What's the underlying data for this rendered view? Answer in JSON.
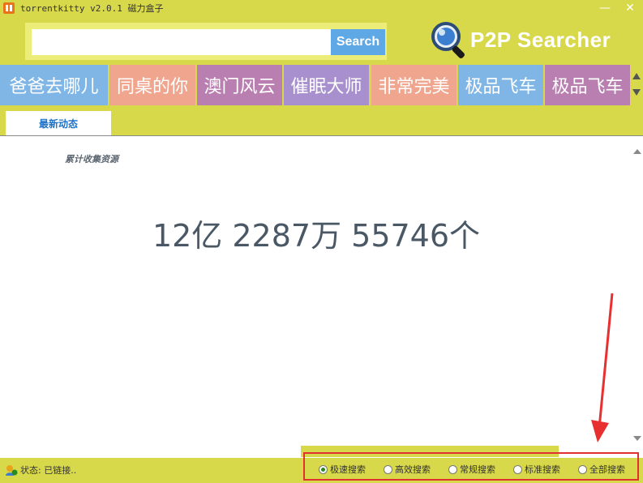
{
  "window": {
    "title": "torrentkitty v2.0.1 磁力盒子",
    "minimize_label": "—",
    "close_label": "✕"
  },
  "search": {
    "input_value": "",
    "button_label": "Search"
  },
  "logo": {
    "text": "P2P Searcher",
    "icon": "magnifier-icon"
  },
  "hot_tabs": [
    {
      "label": "爸爸去哪儿",
      "color": "#7fb6e6"
    },
    {
      "label": "同桌的你",
      "color": "#f0a58e"
    },
    {
      "label": "澳门风云",
      "color": "#b97fb0"
    },
    {
      "label": "催眠大师",
      "color": "#a890cf"
    },
    {
      "label": "非常完美",
      "color": "#f0a58e"
    },
    {
      "label": "极品飞车",
      "color": "#7fb6e6"
    },
    {
      "label": "极品飞车",
      "color": "#b97fb0"
    }
  ],
  "content_tabs": {
    "latest": "最新动态"
  },
  "stats": {
    "label": "累计收集资源",
    "count": "12亿 2287万 55746个"
  },
  "status": {
    "text": "状态: 已链接.."
  },
  "search_modes": [
    {
      "label": "极速搜索",
      "selected": true
    },
    {
      "label": "高效搜索",
      "selected": false
    },
    {
      "label": "常规搜索",
      "selected": false
    },
    {
      "label": "标准搜索",
      "selected": false
    },
    {
      "label": "全部搜索",
      "selected": false
    }
  ],
  "colors": {
    "background": "#d8d94a",
    "search_button": "#5ea8e5",
    "highlight_border": "#e03030"
  }
}
